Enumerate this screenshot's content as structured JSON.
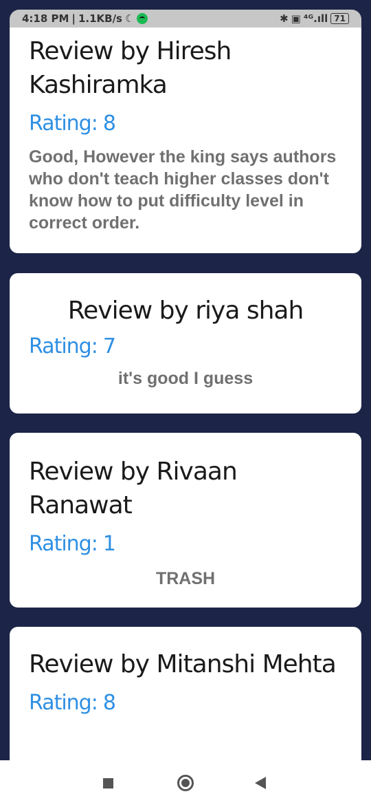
{
  "status_bar": {
    "time": "4:18 PM",
    "speed": "1.1KB/s",
    "battery": "71",
    "icons": [
      "moon-icon",
      "spotify-icon",
      "bluetooth-icon",
      "volte-icon",
      "signal-icon",
      "battery-icon"
    ]
  },
  "rating_label": "Rating:",
  "reviews": [
    {
      "title_prefix": "Review by",
      "reviewer": "Hiresh Kashiramka",
      "rating": "8",
      "text": "Good, However the king says authors who don't teach higher classes don't know how to put difficulty level in correct order."
    },
    {
      "title_prefix": "Review by",
      "reviewer": "riya shah",
      "rating": "7",
      "text": "it's good I guess"
    },
    {
      "title_prefix": "Review by",
      "reviewer": "Rivaan Ranawat",
      "rating": "1",
      "text": "TRASH"
    },
    {
      "title_prefix": "Review by",
      "reviewer": "Mitanshi Mehta",
      "rating": "8",
      "text": ""
    }
  ],
  "nav": {
    "icons": [
      "recents-square-icon",
      "home-circle-icon",
      "back-triangle-icon"
    ]
  },
  "colors": {
    "background": "#1c2447",
    "card": "#ffffff",
    "rating": "#2e8fe3",
    "review_text": "#707070",
    "title": "#1a1a1a"
  }
}
